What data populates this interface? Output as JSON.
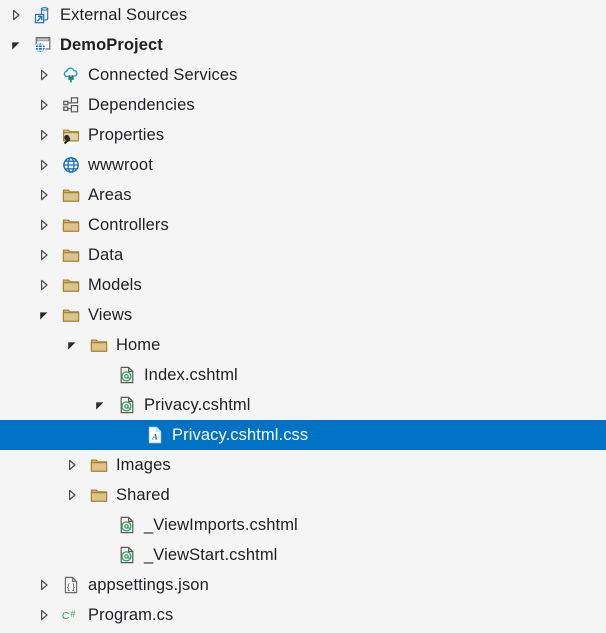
{
  "panel": {
    "name": "solution-explorer-tree",
    "background_color": "#f5f5f5",
    "selection_color": "#0072c6",
    "text_color": "#1f1f24",
    "selected_text_color": "#ffffff"
  },
  "tree": {
    "items": [
      {
        "label": "External Sources",
        "depth": 0,
        "expander": "collapsed",
        "icon": "external-sources-icon",
        "bold": false,
        "selected": false
      },
      {
        "label": "DemoProject",
        "depth": 0,
        "expander": "expanded",
        "icon": "web-project-icon",
        "bold": true,
        "selected": false
      },
      {
        "label": "Connected Services",
        "depth": 1,
        "expander": "collapsed",
        "icon": "connected-services-icon",
        "bold": false,
        "selected": false
      },
      {
        "label": "Dependencies",
        "depth": 1,
        "expander": "collapsed",
        "icon": "dependencies-icon",
        "bold": false,
        "selected": false
      },
      {
        "label": "Properties",
        "depth": 1,
        "expander": "collapsed",
        "icon": "properties-folder-icon",
        "bold": false,
        "selected": false
      },
      {
        "label": "wwwroot",
        "depth": 1,
        "expander": "collapsed",
        "icon": "globe-icon",
        "bold": false,
        "selected": false
      },
      {
        "label": "Areas",
        "depth": 1,
        "expander": "collapsed",
        "icon": "folder-icon",
        "bold": false,
        "selected": false
      },
      {
        "label": "Controllers",
        "depth": 1,
        "expander": "collapsed",
        "icon": "folder-icon",
        "bold": false,
        "selected": false
      },
      {
        "label": "Data",
        "depth": 1,
        "expander": "collapsed",
        "icon": "folder-icon",
        "bold": false,
        "selected": false
      },
      {
        "label": "Models",
        "depth": 1,
        "expander": "collapsed",
        "icon": "folder-icon",
        "bold": false,
        "selected": false
      },
      {
        "label": "Views",
        "depth": 1,
        "expander": "expanded",
        "icon": "folder-icon",
        "bold": false,
        "selected": false
      },
      {
        "label": "Home",
        "depth": 2,
        "expander": "expanded",
        "icon": "folder-icon",
        "bold": false,
        "selected": false
      },
      {
        "label": "Index.cshtml",
        "depth": 3,
        "expander": "none",
        "icon": "cshtml-file-icon",
        "bold": false,
        "selected": false
      },
      {
        "label": "Privacy.cshtml",
        "depth": 3,
        "expander": "expanded",
        "icon": "cshtml-file-icon",
        "bold": false,
        "selected": false
      },
      {
        "label": "Privacy.cshtml.css",
        "depth": 4,
        "expander": "none",
        "icon": "css-file-icon",
        "bold": false,
        "selected": true
      },
      {
        "label": "Images",
        "depth": 2,
        "expander": "collapsed",
        "icon": "folder-icon",
        "bold": false,
        "selected": false
      },
      {
        "label": "Shared",
        "depth": 2,
        "expander": "collapsed",
        "icon": "folder-icon",
        "bold": false,
        "selected": false
      },
      {
        "label": "_ViewImports.cshtml",
        "depth": 3,
        "expander": "none",
        "icon": "cshtml-file-icon",
        "bold": false,
        "selected": false
      },
      {
        "label": "_ViewStart.cshtml",
        "depth": 3,
        "expander": "none",
        "icon": "cshtml-file-icon",
        "bold": false,
        "selected": false
      },
      {
        "label": "appsettings.json",
        "depth": 1,
        "expander": "collapsed",
        "icon": "json-file-icon",
        "bold": false,
        "selected": false
      },
      {
        "label": "Program.cs",
        "depth": 1,
        "expander": "collapsed",
        "icon": "csharp-file-icon",
        "bold": false,
        "selected": false
      }
    ]
  }
}
